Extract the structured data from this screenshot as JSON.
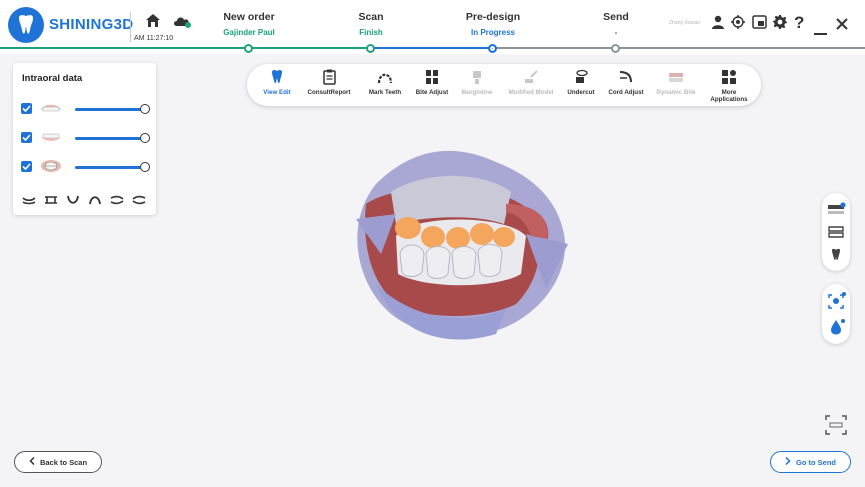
{
  "app": {
    "brand": "SHINING3D",
    "time": "AM 11:27:10",
    "user": "Zhang Xiaoan"
  },
  "steps": [
    {
      "title": "New order",
      "sub": "Gajinder Paul",
      "state": "done"
    },
    {
      "title": "Scan",
      "sub": "Finish",
      "state": "done"
    },
    {
      "title": "Pre-design",
      "sub": "In Progress",
      "state": "current"
    },
    {
      "title": "Send",
      "sub": "-",
      "state": "pending"
    }
  ],
  "header_icons": [
    "user-icon",
    "settings-target-icon",
    "screenshot-icon",
    "gear-icon",
    "help-icon",
    "minimize-icon",
    "close-icon"
  ],
  "left_panel": {
    "title": "Intraoral data",
    "layers": [
      {
        "name": "upper-jaw",
        "checked": true,
        "opacity": 1.0
      },
      {
        "name": "lower-jaw",
        "checked": true,
        "opacity": 1.0
      },
      {
        "name": "bite",
        "checked": true,
        "opacity": 1.0
      }
    ],
    "view_icons": [
      "view-top-icon",
      "view-front-icon",
      "view-lower-icon",
      "view-upper-icon",
      "view-left-icon",
      "view-right-icon"
    ]
  },
  "toolbar": {
    "tools": [
      {
        "label": "View Edit",
        "state": "active"
      },
      {
        "label": "ConsultReport",
        "state": "normal"
      },
      {
        "label": "Mark Teeth",
        "state": "normal"
      },
      {
        "label": "Bite Adjust",
        "state": "normal"
      },
      {
        "label": "Marginline",
        "state": "disabled"
      },
      {
        "label": "Modified Model",
        "state": "disabled"
      },
      {
        "label": "Undercut",
        "state": "normal"
      },
      {
        "label": "Cord Adjust",
        "state": "normal"
      },
      {
        "label": "Dynamic Bite",
        "state": "disabled"
      },
      {
        "label": "More Applications",
        "state": "normal"
      }
    ]
  },
  "colors": {
    "brand": "#1f73d6",
    "done": "#1aa37a",
    "disabled": "#bcbcbc"
  },
  "buttons": {
    "back": "Back to Scan",
    "send": "Go to Send"
  }
}
